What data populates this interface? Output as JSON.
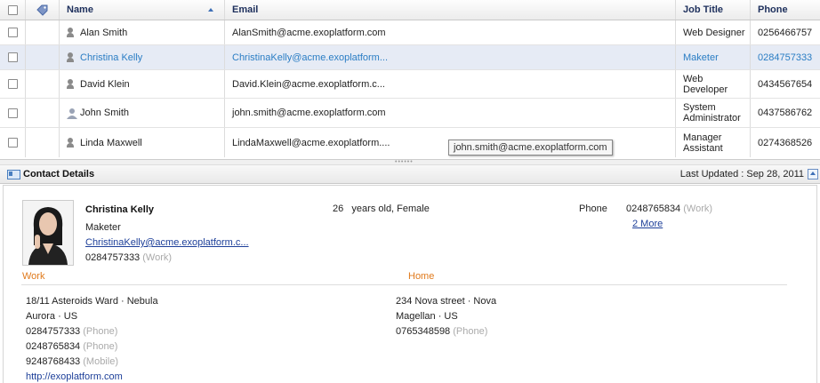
{
  "grid": {
    "columns": {
      "name": "Name",
      "email": "Email",
      "job_title": "Job Title",
      "phone": "Phone"
    },
    "rows": [
      {
        "name": "Alan Smith",
        "email": "AlanSmith@acme.exoplatform.com",
        "job1": "Web Designer",
        "job2": "",
        "phone": "0256466757",
        "icon": "person-icon"
      },
      {
        "name": "Christina Kelly",
        "email": "ChristinaKelly@acme.exoplatform...",
        "job1": "Maketer",
        "job2": "",
        "phone": "0284757333",
        "icon": "person-icon"
      },
      {
        "name": "David Klein",
        "email": "David.Klein@acme.exoplatform.c...",
        "job1": "Web",
        "job2": "Developer",
        "phone": "0434567654",
        "icon": "person-icon"
      },
      {
        "name": "John Smith",
        "email": "john.smith@acme.exoplatform.com",
        "job1": "System",
        "job2": "Administrator",
        "phone": "0437586762",
        "icon": "person-icon"
      },
      {
        "name": "Linda Maxwell",
        "email": "LindaMaxwell@acme.exoplatform....",
        "job1": "Manager",
        "job2": "Assistant",
        "phone": "0274368526",
        "icon": "person-icon"
      }
    ],
    "selected_row": 1
  },
  "tooltip": "john.smith@acme.exoplatform.com",
  "detail_bar": {
    "title": "Contact Details",
    "last_updated": "Last Updated : Sep 28, 2011"
  },
  "contact": {
    "name": "Christina Kelly",
    "job": "Maketer",
    "email": "ChristinaKelly@acme.exoplatform.c...",
    "phone": "0284757333",
    "phone_type": "(Work)",
    "age": "26",
    "age_suffix": "years old, Female",
    "phone_label": "Phone",
    "phone2": "0248765834",
    "phone2_type": "(Work)",
    "more": "2 More"
  },
  "work": {
    "title": "Work",
    "addr1": "18/11 Asteroids Ward  · Nebula",
    "addr2": "Aurora · US",
    "phone1": "0284757333",
    "phone1_type": "(Phone)",
    "phone2": "0248765834",
    "phone2_type": "(Phone)",
    "phone3": "9248768433",
    "phone3_type": "(Mobile)",
    "website": "http://exoplatform.com"
  },
  "home": {
    "title": "Home",
    "addr1": "234 Nova street · Nova",
    "addr2": "Magellan · US",
    "phone1": "0765348598",
    "phone1_type": "(Phone)"
  },
  "colors": {
    "accent": "#2a7dc4",
    "header_text": "#1d2f5c",
    "section_title": "#e07a1c"
  }
}
